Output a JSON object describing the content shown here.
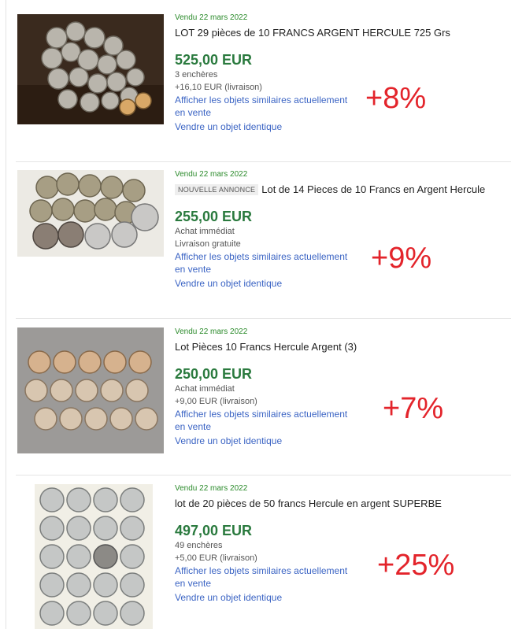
{
  "listings": [
    {
      "sold": "Vendu 22 mars 2022",
      "badge": "",
      "title": "LOT 29 pièces de 10 FRANCS ARGENT HERCULE  725 Grs",
      "price": "525,00 EUR",
      "line1": "3 enchères",
      "line2": "+16,10 EUR (livraison)",
      "similar": "Afficher les objets similaires actuellement en vente",
      "sell": "Vendre un objet identique",
      "gain": "+8%"
    },
    {
      "sold": "Vendu 22 mars 2022",
      "badge": "NOUVELLE ANNONCE",
      "title": "Lot de 14 Pieces de 10 Francs en Argent Hercule",
      "price": "255,00 EUR",
      "line1": "Achat immédiat",
      "line2": "Livraison gratuite",
      "similar": "Afficher les objets similaires actuellement en vente",
      "sell": "Vendre un objet identique",
      "gain": "+9%"
    },
    {
      "sold": "Vendu 22 mars 2022",
      "badge": "",
      "title": "Lot Pièces 10 Francs Hercule Argent (3)",
      "price": "250,00 EUR",
      "line1": "Achat immédiat",
      "line2": "+9,00 EUR (livraison)",
      "similar": "Afficher les objets similaires actuellement en vente",
      "sell": "Vendre un objet identique",
      "gain": "+7%"
    },
    {
      "sold": "Vendu 22 mars 2022",
      "badge": "",
      "title": "lot de 20 pièces de 50 francs Hercule en argent SUPERBE",
      "price": "497,00 EUR",
      "line1": "49 enchères",
      "line2": "+5,00 EUR (livraison)",
      "similar": "Afficher les objets similaires actuellement en vente",
      "sell": "Vendre un objet identique",
      "gain": "+25%"
    }
  ],
  "colors": {
    "sold": "#2a8a2a",
    "price": "#2a7a3e",
    "link": "#3b64c4",
    "gain": "#e3242b"
  }
}
